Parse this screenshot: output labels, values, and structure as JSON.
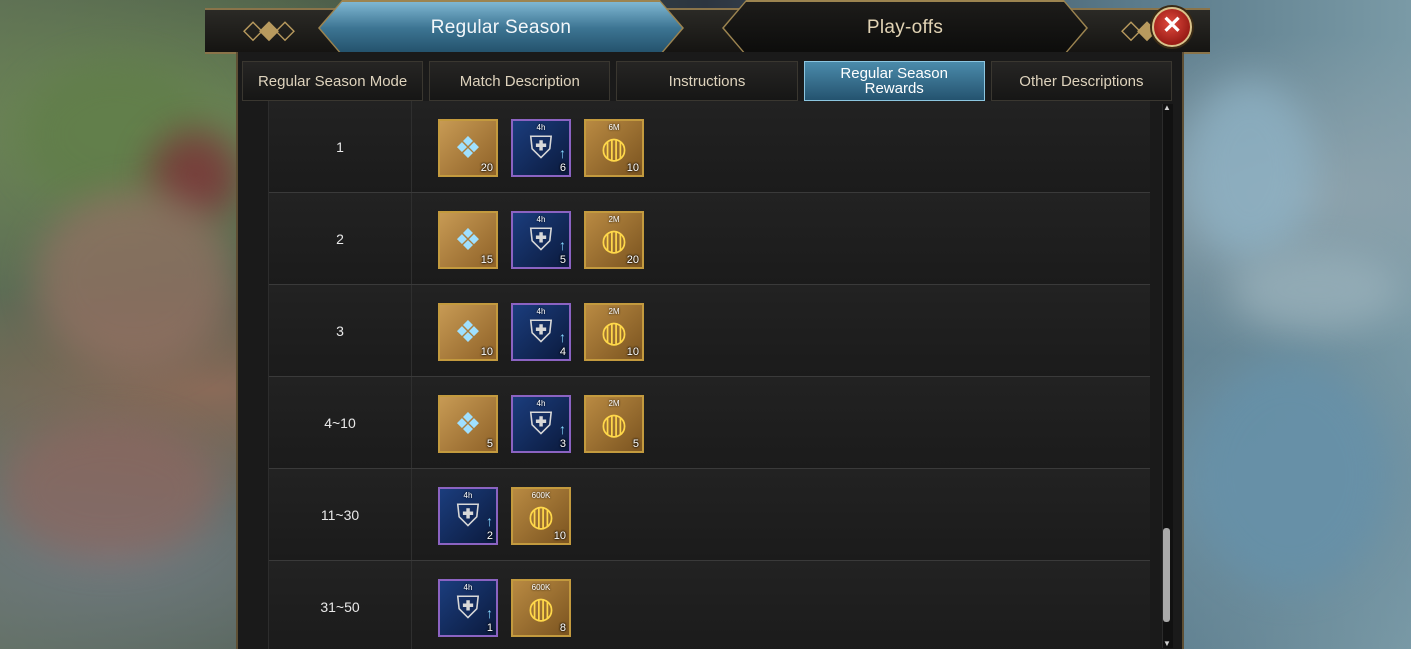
{
  "header": {
    "tabs": [
      {
        "label": "Regular Season",
        "active": true
      },
      {
        "label": "Play-offs",
        "active": false
      }
    ],
    "close_icon": "close-x-icon"
  },
  "subtabs": [
    {
      "label": "Regular Season Mode",
      "active": false
    },
    {
      "label": "Match Description",
      "active": false
    },
    {
      "label": "Instructions",
      "active": false
    },
    {
      "label": "Regular Season Rewards",
      "active": true
    },
    {
      "label": "Other Descriptions",
      "active": false
    }
  ],
  "rows": [
    {
      "rank": "1",
      "rewards": [
        {
          "type": "gear-chest",
          "quantity": "20"
        },
        {
          "type": "shield-boost",
          "duration": "4h",
          "quantity": "6"
        },
        {
          "type": "gold-coins",
          "amount": "6M",
          "quantity": "10"
        }
      ]
    },
    {
      "rank": "2",
      "rewards": [
        {
          "type": "gear-chest",
          "quantity": "15"
        },
        {
          "type": "shield-boost",
          "duration": "4h",
          "quantity": "5"
        },
        {
          "type": "gold-coins",
          "amount": "2M",
          "quantity": "20"
        }
      ]
    },
    {
      "rank": "3",
      "rewards": [
        {
          "type": "gear-chest",
          "quantity": "10"
        },
        {
          "type": "shield-boost",
          "duration": "4h",
          "quantity": "4"
        },
        {
          "type": "gold-coins",
          "amount": "2M",
          "quantity": "10"
        }
      ]
    },
    {
      "rank": "4~10",
      "rewards": [
        {
          "type": "gear-chest",
          "quantity": "5"
        },
        {
          "type": "shield-boost",
          "duration": "4h",
          "quantity": "3"
        },
        {
          "type": "gold-coins",
          "amount": "2M",
          "quantity": "5"
        }
      ]
    },
    {
      "rank": "11~30",
      "rewards": [
        {
          "type": "shield-boost",
          "duration": "4h",
          "quantity": "2"
        },
        {
          "type": "gold-coins",
          "amount": "600K",
          "quantity": "10"
        }
      ]
    },
    {
      "rank": "31~50",
      "rewards": [
        {
          "type": "shield-boost",
          "duration": "4h",
          "quantity": "1"
        },
        {
          "type": "gold-coins",
          "amount": "600K",
          "quantity": "8"
        }
      ]
    }
  ]
}
